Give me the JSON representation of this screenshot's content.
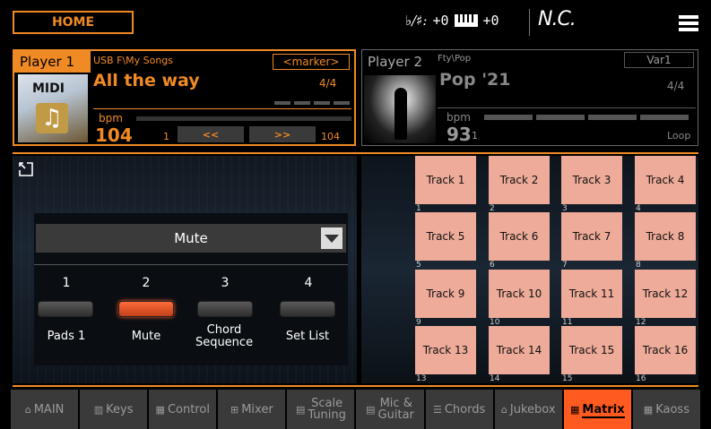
{
  "topbar": {
    "home_label": "HOME",
    "transpose_glyph": "♭/♯:",
    "transpose_value": "+0",
    "octave_value": "+0",
    "chord_name": "N.C."
  },
  "player1": {
    "label": "Player 1",
    "thumb_text": "MIDI",
    "path": "USB F\\My Songs",
    "marker": "<marker>",
    "song": "All the way",
    "time_sig": "4/4",
    "bpm_label": "bpm",
    "bpm": "104",
    "bar_start": "1",
    "rewind": "<<",
    "forward": ">>",
    "bar_end": "104"
  },
  "player2": {
    "label": "Player 2",
    "path": "Fty\\Pop",
    "variation": "Var1",
    "style": "Pop '21",
    "time_sig": "4/4",
    "bpm_label": "bpm",
    "bpm": "93",
    "bar": "1",
    "loop": "Loop"
  },
  "pads": {
    "select_value": "Mute",
    "items": [
      {
        "num": "1",
        "label": "Pads 1",
        "lit": false
      },
      {
        "num": "2",
        "label": "Mute",
        "lit": true
      },
      {
        "num": "3",
        "label": "Chord Sequence",
        "lit": false
      },
      {
        "num": "4",
        "label": "Set List",
        "lit": false
      }
    ]
  },
  "matrix": {
    "tracks": [
      "Track 1",
      "Track 2",
      "Track 3",
      "Track 4",
      "Track 5",
      "Track 6",
      "Track 7",
      "Track 8",
      "Track 9",
      "Track 10",
      "Track 11",
      "Track 12",
      "Track 13",
      "Track 14",
      "Track 15",
      "Track 16"
    ],
    "indices": [
      "1",
      "2",
      "3",
      "4",
      "5",
      "6",
      "7",
      "8",
      "9",
      "10",
      "11",
      "12",
      "13",
      "14",
      "15",
      "16"
    ],
    "color": "#eeab99"
  },
  "tabs": [
    {
      "icon": "home-icon",
      "label": "MAIN"
    },
    {
      "icon": "keys-icon",
      "label": "Keys"
    },
    {
      "icon": "control-icon",
      "label": "Control"
    },
    {
      "icon": "mixer-icon",
      "label": "Mixer"
    },
    {
      "icon": "scale-icon",
      "label": "Scale",
      "label2": "Tuning"
    },
    {
      "icon": "mic-icon",
      "label": "Mic &",
      "label2": "Guitar"
    },
    {
      "icon": "chords-icon",
      "label": "Chords"
    },
    {
      "icon": "jukebox-icon",
      "label": "Jukebox"
    },
    {
      "icon": "matrix-icon",
      "label": "Matrix",
      "active": true
    },
    {
      "icon": "kaoss-icon",
      "label": "Kaoss"
    }
  ],
  "colors": {
    "accent": "#f08a24",
    "active_tab": "#ff5a1f",
    "pad_lit": "#ff5a2a"
  }
}
